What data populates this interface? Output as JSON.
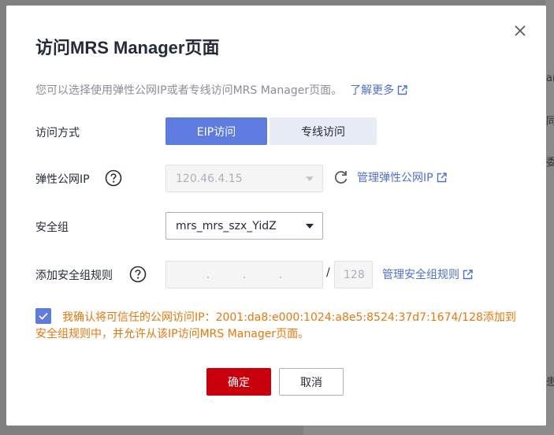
{
  "dialog": {
    "title": "访问MRS Manager页面",
    "description": "您可以选择使用弹性公网IP或者专线访问MRS Manager页面。",
    "learn_more": "了解更多"
  },
  "access_mode": {
    "label": "访问方式",
    "options": [
      "EIP访问",
      "专线访问"
    ],
    "selected": "EIP访问"
  },
  "eip": {
    "label": "弹性公网IP",
    "value": "120.46.4.15",
    "manage_link": "管理弹性公网IP"
  },
  "security_group": {
    "label": "安全组",
    "value": "mrs_mrs_szx_YidZ"
  },
  "rule": {
    "label": "添加安全组规则",
    "ip_dots": [
      ".",
      ".",
      "."
    ],
    "slash": "/",
    "mask": "128",
    "manage_link": "管理安全组规则"
  },
  "confirm": {
    "checked": true,
    "text": "我确认将可信任的公网访问IP：2001:da8:e000:1024:a8e5:8524:37d7:1674/128添加到安全组规则中，并允许从该IP访问MRS Manager页面。"
  },
  "buttons": {
    "ok": "确定",
    "cancel": "取消"
  },
  "background": {
    "right_fragments": [
      "an",
      "同",
      "委",
      "患"
    ]
  },
  "colors": {
    "accent": "#5e7ce0",
    "primary_button": "#c7000b",
    "link": "#526ecc",
    "warning_text": "#e6780e"
  }
}
